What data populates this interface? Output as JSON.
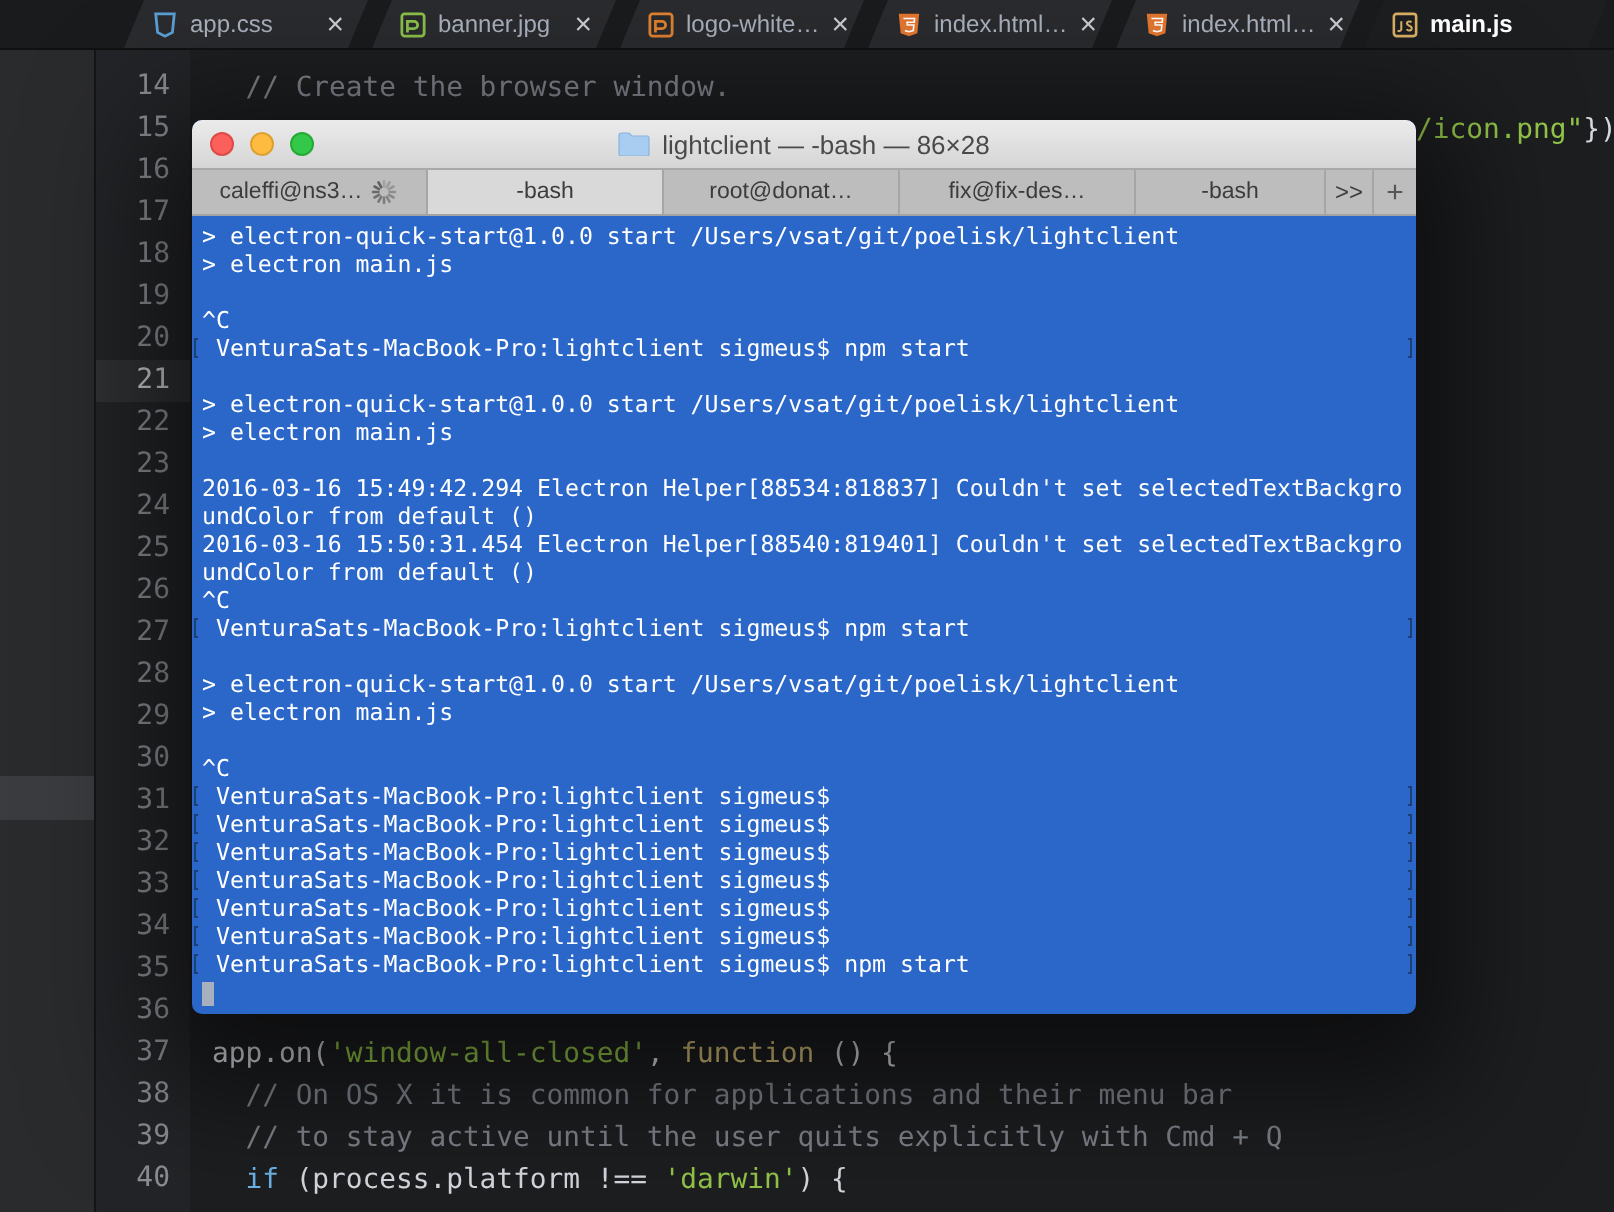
{
  "editor": {
    "tabs": [
      {
        "label": "app.css",
        "kind": "css",
        "selected": false,
        "close": "×"
      },
      {
        "label": "banner.jpg",
        "kind": "image",
        "selected": false,
        "close": "×"
      },
      {
        "label": "logo-white…",
        "kind": "image-alt",
        "selected": false,
        "close": "×"
      },
      {
        "label": "index.html…",
        "kind": "html",
        "selected": false,
        "close": "×"
      },
      {
        "label": "index.html…",
        "kind": "html",
        "selected": false,
        "close": "×"
      },
      {
        "label": "main.js",
        "kind": "js",
        "selected": true
      }
    ],
    "lines": [
      {
        "number": "14",
        "current": false,
        "kind": "code",
        "segments": [
          {
            "text": "  // Create the browser window.",
            "kind": "comment"
          }
        ]
      },
      {
        "number": "15",
        "current": false,
        "kind": "tail",
        "segments": [
          {
            "text": "/icon.png\"",
            "kind": "string"
          },
          {
            "text": "})",
            "kind": "plain"
          }
        ]
      },
      {
        "number": "16",
        "current": false
      },
      {
        "number": "17",
        "current": false
      },
      {
        "number": "18",
        "current": false
      },
      {
        "number": "19",
        "current": false
      },
      {
        "number": "20",
        "current": false
      },
      {
        "number": "21",
        "current": true
      },
      {
        "number": "22",
        "current": false
      },
      {
        "number": "23",
        "current": false
      },
      {
        "number": "24",
        "current": false
      },
      {
        "number": "25",
        "current": false
      },
      {
        "number": "26",
        "current": false
      },
      {
        "number": "27",
        "current": false
      },
      {
        "number": "28",
        "current": false
      },
      {
        "number": "29",
        "current": false
      },
      {
        "number": "30",
        "current": false
      },
      {
        "number": "31",
        "current": false
      },
      {
        "number": "32",
        "current": false
      },
      {
        "number": "33",
        "current": false
      },
      {
        "number": "34",
        "current": false
      },
      {
        "number": "35",
        "current": false
      },
      {
        "number": "36",
        "current": false
      },
      {
        "number": "37",
        "current": false,
        "kind": "code",
        "segments": [
          {
            "text": "app.on(",
            "kind": "plain"
          },
          {
            "text": "'window-all-closed'",
            "kind": "string"
          },
          {
            "text": ", ",
            "kind": "plain"
          },
          {
            "text": "function",
            "kind": "keyword"
          },
          {
            "text": " () {",
            "kind": "plain"
          }
        ]
      },
      {
        "number": "38",
        "current": false,
        "kind": "code",
        "segments": [
          {
            "text": "  // On OS X it is common for applications and their menu bar",
            "kind": "comment"
          }
        ]
      },
      {
        "number": "39",
        "current": false,
        "kind": "code",
        "segments": [
          {
            "text": "  // to stay active until the user quits explicitly with Cmd + Q",
            "kind": "comment"
          }
        ]
      },
      {
        "number": "40",
        "current": false,
        "kind": "code",
        "segments": [
          {
            "text": "  if",
            "kind": "control"
          },
          {
            "text": " (process.platform !== ",
            "kind": "plain"
          },
          {
            "text": "'darwin'",
            "kind": "string"
          },
          {
            "text": ") {",
            "kind": "plain"
          }
        ]
      }
    ]
  },
  "terminal": {
    "title": "lightclient — -bash — 86×28",
    "tabs": [
      {
        "label": "caleffi@ns3…",
        "busy": true,
        "selected": false
      },
      {
        "label": "-bash",
        "busy": false,
        "selected": true
      },
      {
        "label": "root@donat…",
        "busy": false,
        "selected": false
      },
      {
        "label": "fix@fix-des…",
        "busy": false,
        "selected": false
      },
      {
        "label": "-bash",
        "busy": false,
        "selected": false
      }
    ],
    "overflow": ">>",
    "add": "+",
    "lines": [
      {
        "kind": "output",
        "text": "> electron-quick-start@1.0.0 start /Users/vsat/git/poelisk/lightclient"
      },
      {
        "kind": "output",
        "text": "> electron main.js"
      },
      {
        "kind": "blank"
      },
      {
        "kind": "output",
        "text": "^C"
      },
      {
        "kind": "prompt",
        "text": "VenturaSats-MacBook-Pro:lightclient sigmeus$ npm start"
      },
      {
        "kind": "blank"
      },
      {
        "kind": "output",
        "text": "> electron-quick-start@1.0.0 start /Users/vsat/git/poelisk/lightclient"
      },
      {
        "kind": "output",
        "text": "> electron main.js"
      },
      {
        "kind": "blank"
      },
      {
        "kind": "output",
        "text": "2016-03-16 15:49:42.294 Electron Helper[88534:818837] Couldn't set selectedTextBackgro"
      },
      {
        "kind": "output",
        "text": "undColor from default ()"
      },
      {
        "kind": "output",
        "text": "2016-03-16 15:50:31.454 Electron Helper[88540:819401] Couldn't set selectedTextBackgro"
      },
      {
        "kind": "output",
        "text": "undColor from default ()"
      },
      {
        "kind": "output",
        "text": "^C"
      },
      {
        "kind": "prompt",
        "text": "VenturaSats-MacBook-Pro:lightclient sigmeus$ npm start"
      },
      {
        "kind": "blank"
      },
      {
        "kind": "output",
        "text": "> electron-quick-start@1.0.0 start /Users/vsat/git/poelisk/lightclient"
      },
      {
        "kind": "output",
        "text": "> electron main.js"
      },
      {
        "kind": "blank"
      },
      {
        "kind": "output",
        "text": "^C"
      },
      {
        "kind": "prompt",
        "text": "VenturaSats-MacBook-Pro:lightclient sigmeus$"
      },
      {
        "kind": "prompt",
        "text": "VenturaSats-MacBook-Pro:lightclient sigmeus$"
      },
      {
        "kind": "prompt",
        "text": "VenturaSats-MacBook-Pro:lightclient sigmeus$"
      },
      {
        "kind": "prompt",
        "text": "VenturaSats-MacBook-Pro:lightclient sigmeus$"
      },
      {
        "kind": "prompt",
        "text": "VenturaSats-MacBook-Pro:lightclient sigmeus$"
      },
      {
        "kind": "prompt",
        "text": "VenturaSats-MacBook-Pro:lightclient sigmeus$"
      },
      {
        "kind": "prompt",
        "text": "VenturaSats-MacBook-Pro:lightclient sigmeus$ npm start"
      },
      {
        "kind": "cursor"
      }
    ]
  }
}
